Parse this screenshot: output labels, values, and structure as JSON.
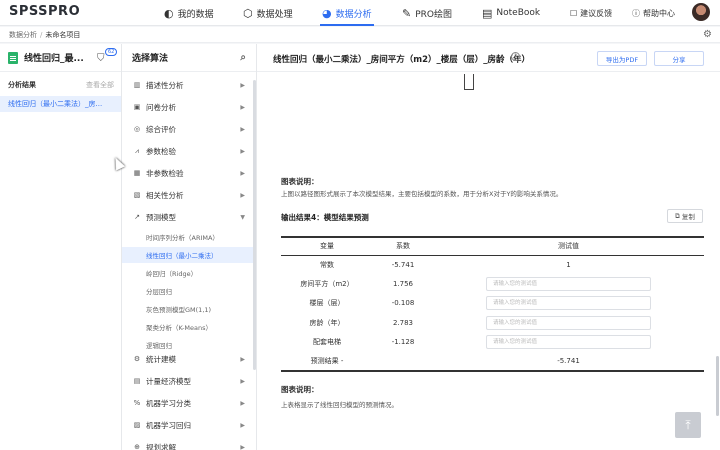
{
  "app": {
    "logo": "SPSSPRO"
  },
  "nav": {
    "items": [
      {
        "label": "我的数据",
        "icon": "palette-icon",
        "glyph": "🎨"
      },
      {
        "label": "数据处理",
        "icon": "cube-icon",
        "glyph": "⬡"
      },
      {
        "label": "数据分析",
        "icon": "pie-chart-icon",
        "glyph": "◕",
        "active": true
      },
      {
        "label": "PRO绘图",
        "icon": "compass-icon",
        "glyph": "✎"
      },
      {
        "label": "NoteBook",
        "icon": "notebook-icon",
        "glyph": "▤"
      }
    ],
    "feedback": "建议反馈",
    "help": "帮助中心"
  },
  "breadcrumb": {
    "root": "数据分析",
    "current": "未命名项目"
  },
  "project": {
    "title": "线性回归_最...",
    "filter_badge": "62",
    "results_label": "分析结果",
    "view_all": "查看全部",
    "result_item": "线性回归（最小二乘法）_房..."
  },
  "algo": {
    "title": "选择算法",
    "categories": [
      {
        "label": "描述性分析",
        "glyph": "▥"
      },
      {
        "label": "问卷分析",
        "glyph": "▣"
      },
      {
        "label": "综合评价",
        "glyph": "◎"
      },
      {
        "label": "参数检验",
        "glyph": "⩘"
      },
      {
        "label": "非参数检验",
        "glyph": "▦"
      },
      {
        "label": "相关性分析",
        "glyph": "▧"
      },
      {
        "label": "预测模型",
        "glyph": "↗"
      }
    ],
    "sub_items": [
      "时间序列分析（ARIMA）",
      "线性回归（最小二乘法）",
      "岭回归（Ridge）",
      "分层回归",
      "灰色预测模型GM(1,1)",
      "聚类分析（K-Means）",
      "逻辑回归"
    ],
    "more_categories": [
      {
        "label": "统计建模",
        "glyph": "⚙"
      },
      {
        "label": "计量经济模型",
        "glyph": "▤"
      },
      {
        "label": "机器学习分类",
        "glyph": "%"
      },
      {
        "label": "机器学习回归",
        "glyph": "▨"
      },
      {
        "label": "规划求解",
        "glyph": "⊕"
      }
    ]
  },
  "main": {
    "title": "线性回归（最小二乘法）_房间平方（m2）_楼层（层）_房龄（年）",
    "export_pdf": "导出为PDF",
    "share": "分享",
    "note1_title": "图表说明：",
    "note1_text": "上图以路径图形式展示了本次模型结果，主要包括模型的系数，用于分析X对于Y的影响关系情况。",
    "output_title": "输出结果4：模型结果预测",
    "copy": "复制",
    "table": {
      "headers": [
        "变量",
        "系数",
        "测试值"
      ],
      "rows": [
        {
          "name": "常数",
          "coef": "-5.741",
          "value": "1",
          "input": false
        },
        {
          "name": "房间平方（m2）",
          "coef": "1.756",
          "input": true
        },
        {
          "name": "楼层（层）",
          "coef": "-0.108",
          "input": true
        },
        {
          "name": "房龄（年）",
          "coef": "2.783",
          "input": true
        },
        {
          "name": "配套电梯",
          "coef": "-1.128",
          "input": true
        },
        {
          "name": "预测结果 -",
          "coef": "",
          "value": "-5.741",
          "input": false
        }
      ],
      "placeholder": "请输入您的测试值"
    },
    "note2_title": "图表说明：",
    "note2_text": "上表格显示了线性回归模型的预测情况。"
  }
}
